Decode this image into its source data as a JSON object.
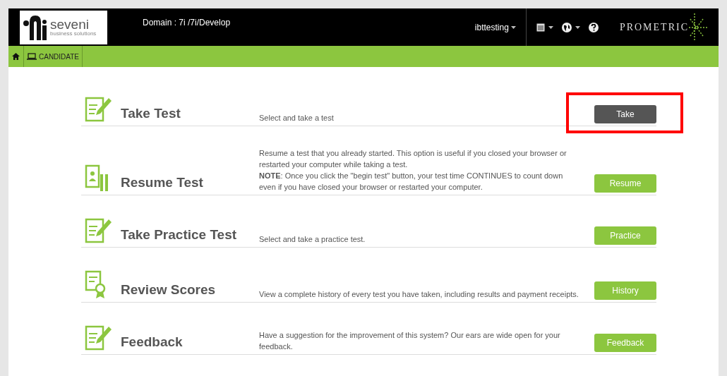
{
  "header": {
    "logo": {
      "name": "seveni",
      "tagline": "business solutions"
    },
    "domain": "Domain : 7i /7i/Develop",
    "user": "ibttesting",
    "brand": "PROMETRIC"
  },
  "nav": {
    "items": [
      {
        "kind": "home"
      },
      {
        "kind": "tab",
        "label": "CANDIDATE"
      }
    ]
  },
  "actions": [
    {
      "kind": "edit",
      "title": "Take Test",
      "description": [
        "Select and take a test"
      ],
      "button": {
        "label": "Take",
        "kind": "dark"
      },
      "highlighted": true
    },
    {
      "kind": "resume",
      "title": "Resume Test",
      "description": [
        "Resume a test that you already started. This option is useful if you closed your browser or restarted your computer while taking a test.",
        "**NOTE**: Once you click the \"begin test\" button, your test time CONTINUES to count down even if you have closed your browser or restarted your computer."
      ],
      "button": {
        "label": "Resume",
        "kind": "green"
      },
      "highlighted": false
    },
    {
      "kind": "edit",
      "title": "Take Practice Test",
      "description": [
        "Select and take a practice test."
      ],
      "button": {
        "label": "Practice",
        "kind": "green"
      },
      "highlighted": false
    },
    {
      "kind": "award",
      "title": "Review Scores",
      "description": [
        "View a complete history of every test you have taken, including results and payment receipts."
      ],
      "button": {
        "label": "History",
        "kind": "green"
      },
      "highlighted": false
    },
    {
      "kind": "edit",
      "title": "Feedback",
      "description": [
        "Have a suggestion for the improvement of this system? Our ears are wide open for your feedback."
      ],
      "button": {
        "label": "Feedback",
        "kind": "green"
      },
      "highlighted": false
    }
  ]
}
